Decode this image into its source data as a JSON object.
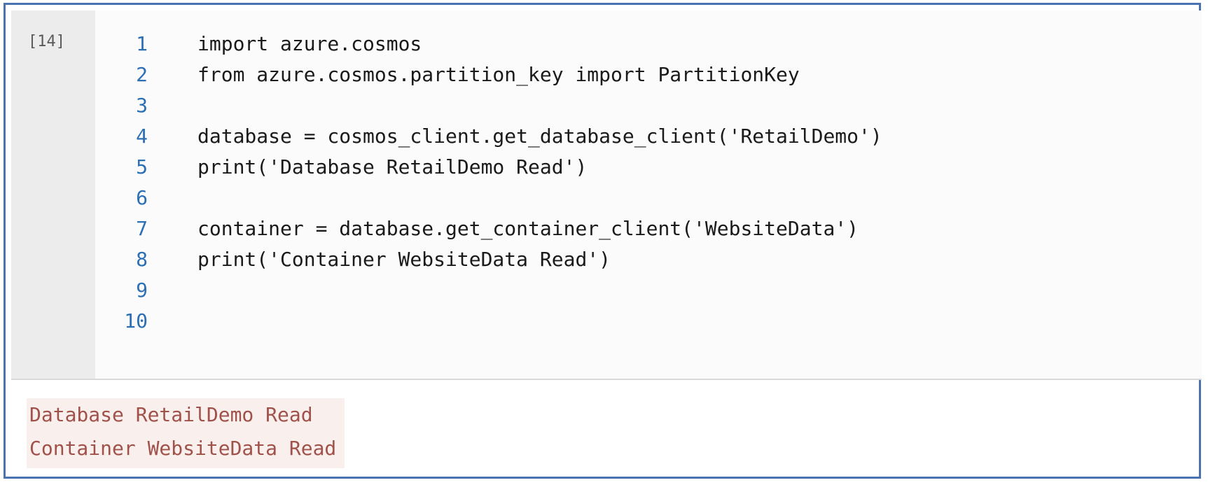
{
  "cell": {
    "execution_count": "[14]",
    "lines": [
      {
        "number": "1",
        "code": "import azure.cosmos"
      },
      {
        "number": "2",
        "code": "from azure.cosmos.partition_key import PartitionKey"
      },
      {
        "number": "3",
        "code": ""
      },
      {
        "number": "4",
        "code": "database = cosmos_client.get_database_client('RetailDemo')"
      },
      {
        "number": "5",
        "code": "print('Database RetailDemo Read')"
      },
      {
        "number": "6",
        "code": ""
      },
      {
        "number": "7",
        "code": "container = database.get_container_client('WebsiteData')"
      },
      {
        "number": "8",
        "code": "print('Container WebsiteData Read')"
      },
      {
        "number": "9",
        "code": ""
      },
      {
        "number": "10",
        "code": ""
      }
    ]
  },
  "output": {
    "lines": [
      "Database RetailDemo Read",
      "Container WebsiteData Read"
    ]
  },
  "colors": {
    "line_numbers": "#2d6fb4",
    "code_text": "#1a1a1a",
    "output_text": "#a0524a",
    "frame_border": "#4a72b0"
  }
}
